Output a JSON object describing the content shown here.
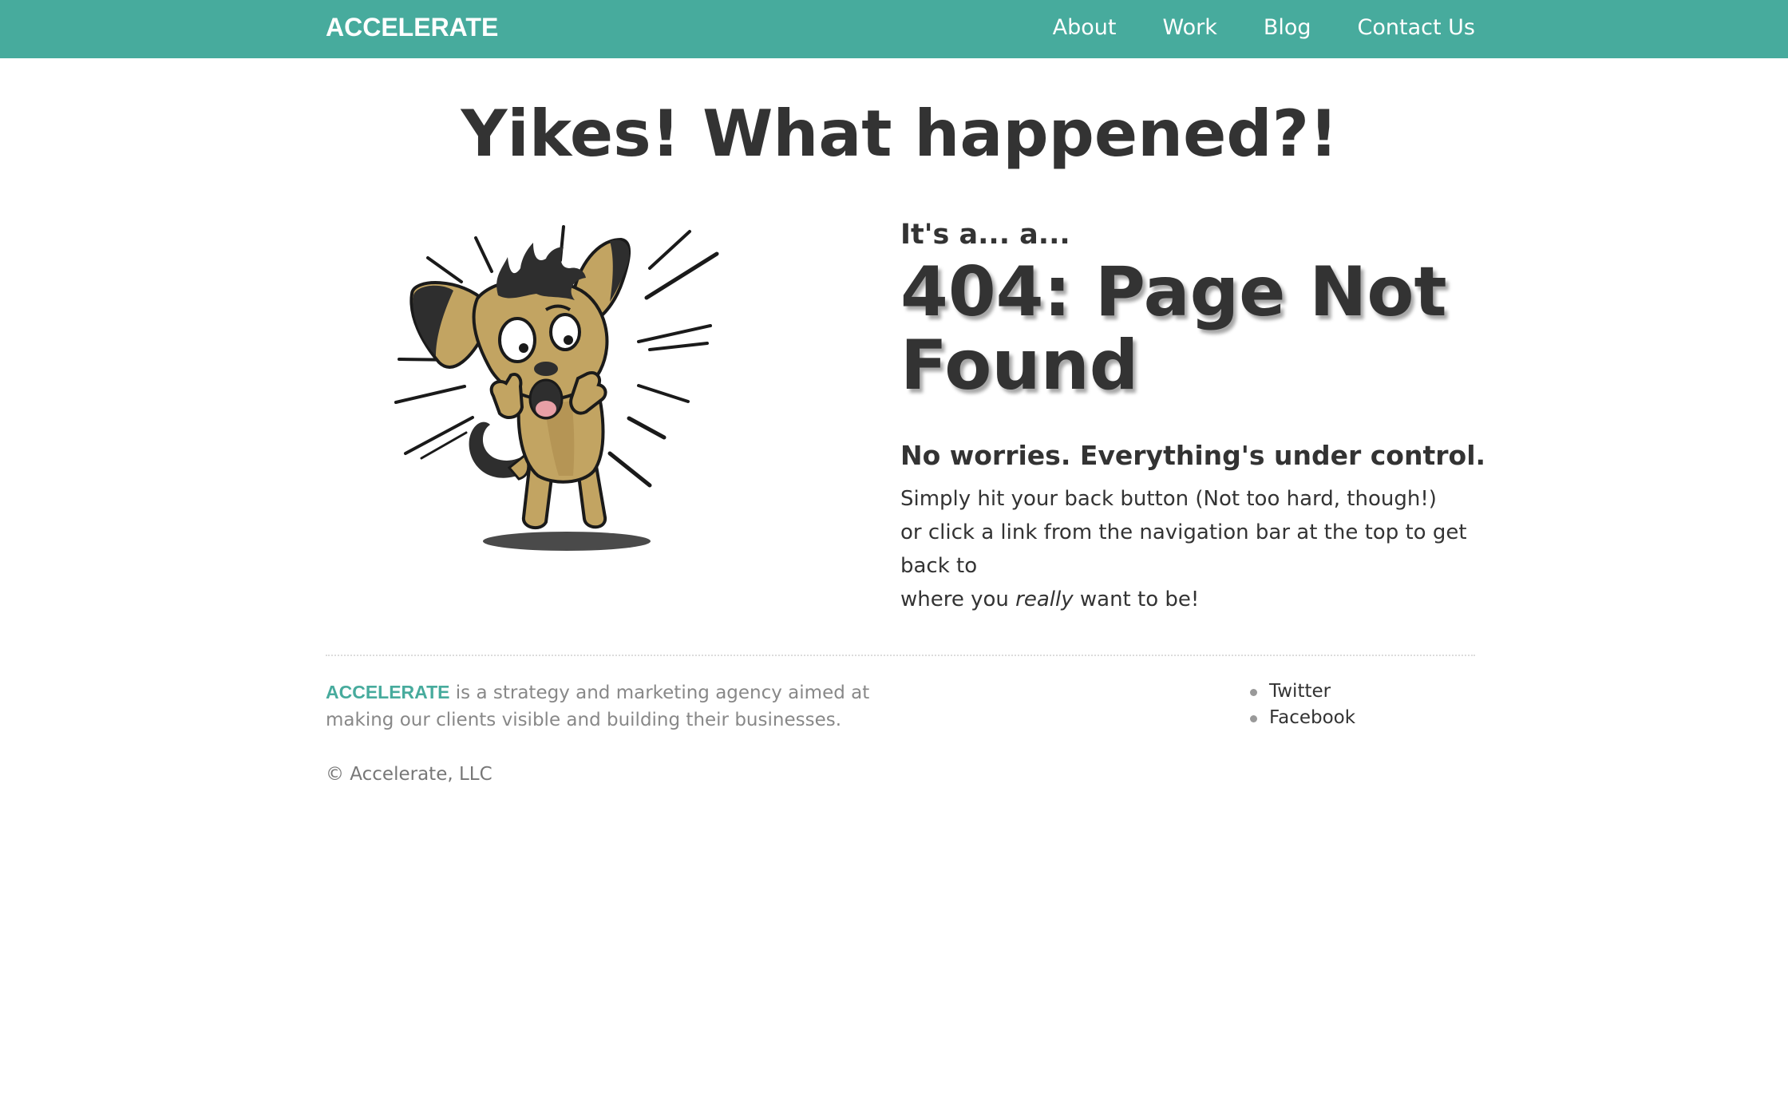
{
  "header": {
    "logo": "ACCELERATE",
    "nav": [
      {
        "label": "About"
      },
      {
        "label": "Work"
      },
      {
        "label": "Blog"
      },
      {
        "label": "Contact Us"
      }
    ],
    "background_color": "#47ab9d"
  },
  "main": {
    "title": "Yikes! What happened?!",
    "kicker": "It's a... a...",
    "error_heading": "404: Page Not Found",
    "subheading": "No worries. Everything's under control.",
    "body": {
      "line1": "Simply hit your back button (Not too hard, though!)",
      "line2": "or click a link from the navigation bar at the top to get back to",
      "line3_before": "where you ",
      "line3_emphasis": "really",
      "line3_after": " want to be!"
    },
    "illustration_icon": "startled-cartoon-dog-icon"
  },
  "footer": {
    "brand": "ACCELERATE",
    "description": " is a strategy and marketing agency aimed at making our clients visible and building their businesses.",
    "copyright": "© Accelerate, LLC",
    "social_links": [
      {
        "label": "Twitter"
      },
      {
        "label": "Facebook"
      }
    ],
    "brand_color": "#47ab9d"
  }
}
